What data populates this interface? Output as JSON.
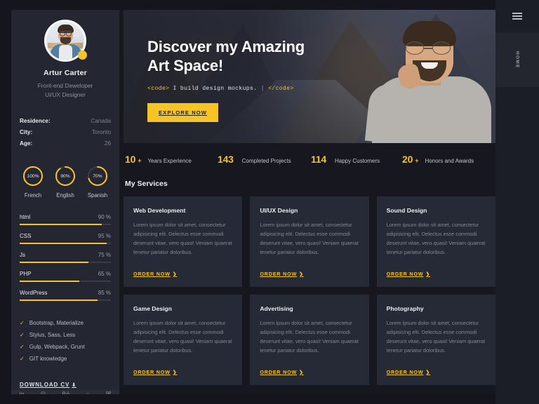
{
  "profile": {
    "name": "Artur Carter",
    "role_line1": "Front-end Deweloper",
    "role_line2": "Ui/UX Designer",
    "avatar_alt": "avatar"
  },
  "info": [
    {
      "key": "Residence:",
      "value": "Canada"
    },
    {
      "key": "City:",
      "value": "Toronto"
    },
    {
      "key": "Age:",
      "value": "26"
    }
  ],
  "languages": [
    {
      "label": "French",
      "pct": 100,
      "pct_text": "100%"
    },
    {
      "label": "English",
      "pct": 90,
      "pct_text": "90%"
    },
    {
      "label": "Spanish",
      "pct": 70,
      "pct_text": "70%"
    }
  ],
  "skills": [
    {
      "name": "html",
      "pct": 90,
      "pct_text": "90 %"
    },
    {
      "name": "CSS",
      "pct": 95,
      "pct_text": "95 %"
    },
    {
      "name": "Js",
      "pct": 75,
      "pct_text": "75 %"
    },
    {
      "name": "PHP",
      "pct": 65,
      "pct_text": "65 %"
    },
    {
      "name": "WordPress",
      "pct": 85,
      "pct_text": "85 %"
    }
  ],
  "knowledge": [
    "Bootstrap, Materialize",
    "Stylus, Sass, Less",
    "Gulp, Webpack, Grunt",
    "GIT knowledge"
  ],
  "download_cv": {
    "label": "DOWNLOAD CV",
    "icon": "download-icon",
    "glyph": "⬇"
  },
  "socials": [
    {
      "name": "linkedin",
      "glyph": "in"
    },
    {
      "name": "instagram",
      "glyph": "◎"
    },
    {
      "name": "behance",
      "glyph": "Bē"
    },
    {
      "name": "github",
      "glyph": "○"
    },
    {
      "name": "twitter",
      "glyph": "✉"
    }
  ],
  "hero": {
    "title_line1": "Discover my Amazing",
    "title_line2": "Art Space!",
    "code_open": "<code>",
    "code_text": "I build design mockups.",
    "code_caret": "|",
    "code_close": "</code>",
    "cta": "EXPLORE NOW"
  },
  "stats": [
    {
      "number": "10",
      "plus": "+",
      "label": "Years Experience"
    },
    {
      "number": "143",
      "plus": "",
      "label": "Completed Projects"
    },
    {
      "number": "114",
      "plus": "",
      "label": "Happy Customers"
    },
    {
      "number": "20",
      "plus": "+",
      "label": "Honors and Awards"
    }
  ],
  "services_heading": "My Services",
  "services": [
    {
      "title": "Web Development",
      "desc": "Lorem ipsum dolor sit amet, consectetur adipisicing elit. Delectus esse commodi deserunt vitae, vero quasi! Veniam quaerat tenetur pariatur doloribus.",
      "action": "ORDER NOW"
    },
    {
      "title": "UI/UX Design",
      "desc": "Lorem ipsum dolor sit amet, consectetur adipisicing elit. Delectus esse commodi deserunt vitae, vero quasi! Veniam quaerat tenetur pariatur doloribus.",
      "action": "ORDER NOW"
    },
    {
      "title": "Sound Design",
      "desc": "Lorem ipsum dolor sit amet, consectetur adipisicing elit. Delectus esse commodi deserunt vitae, vero quasi! Veniam quaerat tenetur pariatur doloribus.",
      "action": "ORDER NOW"
    },
    {
      "title": "Game Design",
      "desc": "Lorem ipsum dolor sit amet, consectetur adipisicing elit. Delectus esse commodi deserunt vitae, vero quasi! Veniam quaerat tenetur pariatur doloribus.",
      "action": "ORDER NOW"
    },
    {
      "title": "Advertising",
      "desc": "Lorem ipsum dolor sit amet, consectetur adipisicing elit. Delectus esse commodi deserunt vitae, vero quasi! Veniam quaerat tenetur pariatur doloribus.",
      "action": "ORDER NOW"
    },
    {
      "title": "Photography",
      "desc": "Lorem ipsum dolor sit amet, consectetur adipisicing elit. Delectus esse commodi deserunt vitae, vero quasi! Veniam quaerat tenetur pariatur doloribus.",
      "action": "ORDER NOW"
    }
  ],
  "rail": {
    "menu_icon": "hamburger-icon",
    "active_nav": "HOME"
  },
  "colors": {
    "accent": "#f7c325",
    "page_bg": "#16171f",
    "panel_bg": "#242631",
    "card_bg": "#262936",
    "rail_bg": "#1c1e27",
    "text": "#eceef2",
    "muted": "#848793"
  }
}
